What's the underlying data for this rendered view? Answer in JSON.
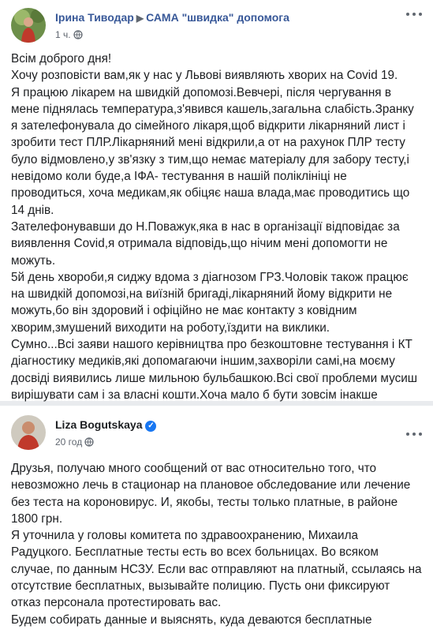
{
  "post1": {
    "author": "Ірина Тиводар",
    "group": "САМА \"швидка\" допомога",
    "time": "1 ч.",
    "text": "Всім доброго дня!\nХочу розповісти вам,як у нас у Львові виявляють хворих на Covid 19.\nЯ працюю лікарем на швидкій допомозі.Вевчері, після чергування в мене піднялась температура,з'явився кашель,загальна слабість.Зранку я зателефонувала до сімейного лікаря,щоб відкрити лікарняний лист і зробити тест ПЛР.Лікарняний мені відкрили,а от на рахунок ПЛР тесту було відмовлено,у зв'язку з тим,що немає матеріалу для забору тесту,і невідомо коли буде,а ІФА- тестування в нашій поліклініці не проводиться, хоча медикам,як обіцяє наша влада,має проводитись що 14 днів.\nЗателефонувавши до Н.Поважук,яка в нас в організації відповідає за виявлення Covid,я отримала відповідь,що нічим мені допомогти не можуть.\n5й день хвороби,я сиджу вдома з діагнозом ГРЗ.Чоловік також працює на швидкій допомозі,на виїзній бригаді,лікарняний йому відкрити не можуть,бо він здоровий і офіційно не має контакту з ковідним хворим,змушений виходити на роботу,їздити на виклики.\nСумно...Всі заяви нашого керівництва про безкоштовне тестування і КТ діагностику медиків,які допомагаючи іншим,захворіли самі,на моєму досвіді виявились лише мильною бульбашкою.Всі свої проблеми мусиш вирішувати сам і за власні кошти.Хоча мало б бути зовсім інакше"
  },
  "post2": {
    "author": "Liza Bogutskaya",
    "time": "20 год",
    "text": "Друзья, получаю много сообщений от вас относительно того, что невозможно лечь в стационар на плановое обследование или лечение без теста на короновирус. И, якобы, тесты только платные, в районе 1800 грн.\nЯ уточнила у головы комитета по здравоохранению, Михаила Радуцкого. Бесплатные тесты есть во всех больницах. Во всяком случае, по данным НСЗУ. Если вас отправляют на платный, ссылаясь на отсутствие бесплатных, вызывайте полицию. Пусть они фиксируют отказ персонала протестировать вас.\nБудем собирать данные и выяснять, куда деваются бесплатные"
  },
  "icons": {
    "globe": "globe-icon",
    "more": "more-options-icon",
    "verified": "verified-badge-icon",
    "arrow": "triangle-right-icon"
  },
  "colors": {
    "link": "#385898",
    "text": "#1c1e21",
    "meta": "#606770",
    "verified": "#1877f2",
    "feed_bg": "#e9ebee"
  }
}
